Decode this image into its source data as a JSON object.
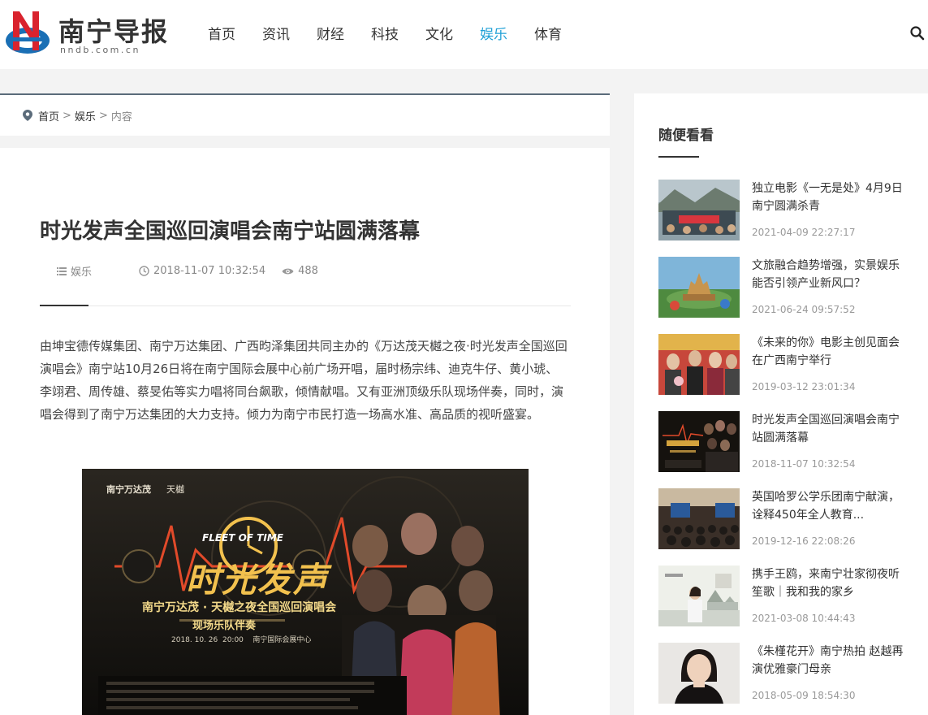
{
  "header": {
    "logo_title": "南宁导报",
    "logo_sub": "nndb.com.cn",
    "nav": [
      "首页",
      "资讯",
      "财经",
      "科技",
      "文化",
      "娱乐",
      "体育"
    ],
    "active_nav": "娱乐",
    "search_icon": "search-icon",
    "colors": {
      "accent": "#1fa0d6",
      "logo_red": "#d9232e",
      "logo_blue": "#1a6fb5"
    }
  },
  "breadcrumb": {
    "home": "首页",
    "sep1": ">",
    "section": "娱乐",
    "sep2": ">",
    "current": "内容"
  },
  "article": {
    "title": "时光发声全国巡回演唱会南宁站圆满落幕",
    "category": "娱乐",
    "datetime": "2018-11-07 10:32:54",
    "views": "488",
    "body": "由坤宝德传媒集团、南宁万达集团、广西昀泽集团共同主办的《万达茂天樾之夜·时光发声全国巡回演唱会》南宁站10月26日将在南宁国际会展中心前广场开唱，届时杨宗纬、迪克牛仔、黄小琥、李翊君、周传雄、蔡旻佑等实力唱将同台飙歌，倾情献唱。又有亚洲顶级乐队现场伴奏，同时，演唱会得到了南宁万达集团的大力支持。倾力为南宁市民打造一场高水准、高品质的视听盛宴。",
    "poster": {
      "brand": "南宁万达茂",
      "brand2": "天樾",
      "en_title": "FLEET OF TIME",
      "cn_title": "时光发声",
      "subtitle": "南宁万达茂 · 天樾之夜全国巡回演唱会",
      "band_line": "现场乐队伴奏",
      "date_line": "2018. 10. 26  20:00    南宁国际会展中心"
    }
  },
  "sidebar": {
    "title": "随便看看",
    "items": [
      {
        "title": "独立电影《一无是处》4月9日南宁圆满杀青",
        "date": "2021-04-09 22:27:17"
      },
      {
        "title": "文旅融合趋势增强，实景娱乐能否引领产业新风口？",
        "date": "2021-06-24 09:57:52"
      },
      {
        "title": "《未来的你》电影主创见面会在广西南宁举行",
        "date": "2019-03-12 23:01:34"
      },
      {
        "title": "时光发声全国巡回演唱会南宁站圆满落幕",
        "date": "2018-11-07 10:32:54"
      },
      {
        "title": "英国哈罗公学乐团南宁献演，诠释450年全人教育...",
        "date": "2019-12-16 22:08:26"
      },
      {
        "title": "携手王鸥，来南宁壮家彻夜听笙歌｜我和我的家乡",
        "date": "2021-03-08 10:44:43"
      },
      {
        "title": "《朱槿花开》南宁热拍 赵越再演优雅豪门母亲",
        "date": "2018-05-09 18:54:30"
      }
    ]
  }
}
